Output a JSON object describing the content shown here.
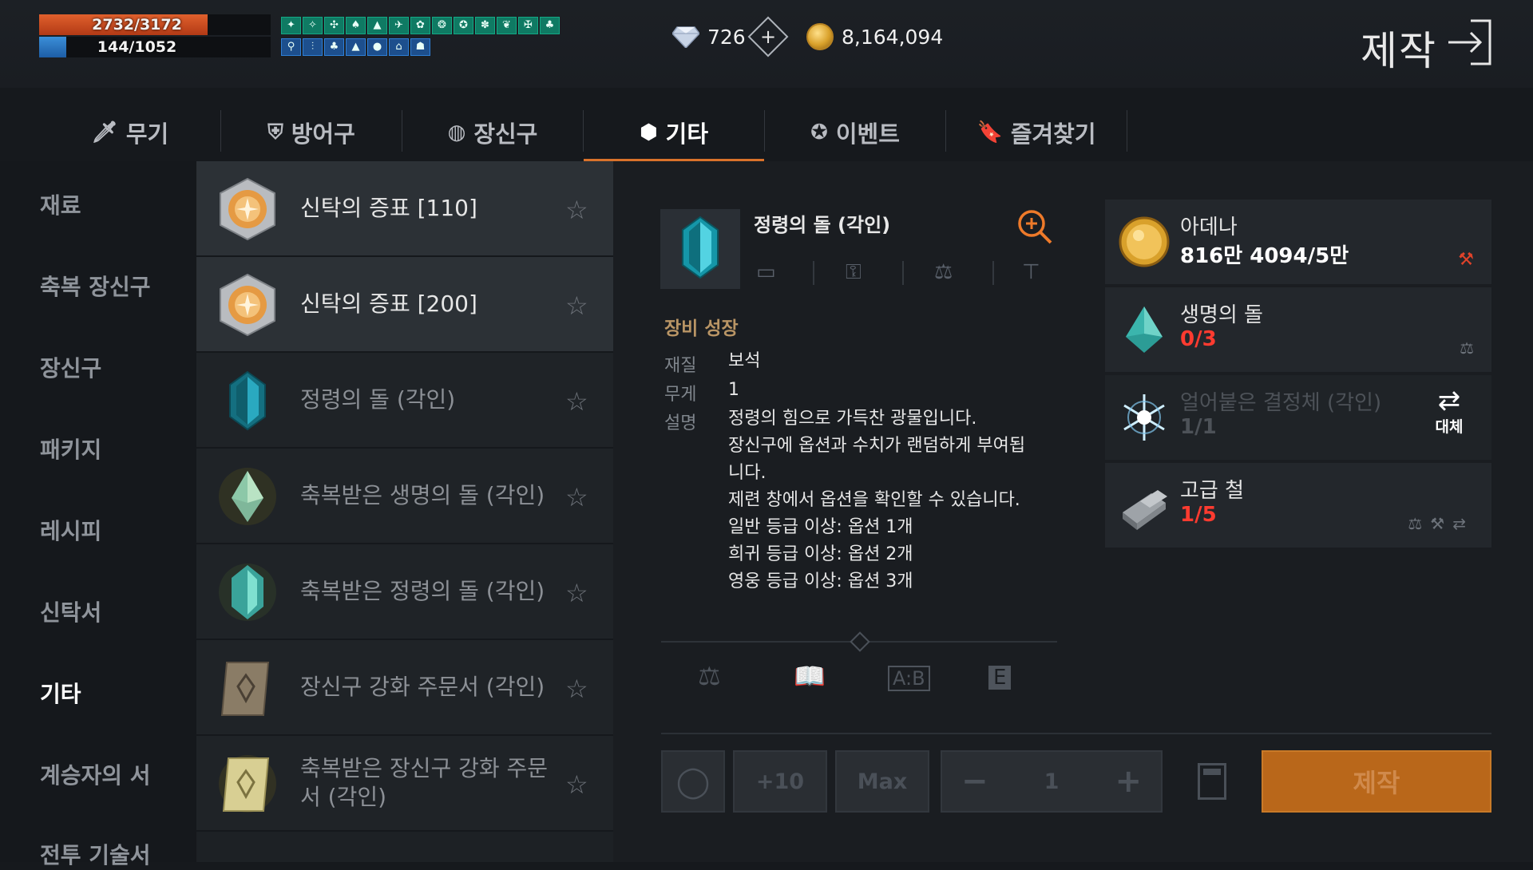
{
  "status": {
    "hp": "2732/3172",
    "mp": "144/1052",
    "hp_fraction": 0.861,
    "mp_fraction": 0.137
  },
  "currency": {
    "diamond": "726",
    "adena": "8,164,094"
  },
  "header": {
    "title": "제작"
  },
  "tabs": [
    {
      "label": "무기",
      "icon": "sword-icon"
    },
    {
      "label": "방어구",
      "icon": "shield-icon"
    },
    {
      "label": "장신구",
      "icon": "ring-icon"
    },
    {
      "label": "기타",
      "icon": "cube-icon",
      "active": true
    },
    {
      "label": "이벤트",
      "icon": "event-icon"
    },
    {
      "label": "즐겨찾기",
      "icon": "bookmark-icon"
    }
  ],
  "sidebar": {
    "items": [
      {
        "label": "재료"
      },
      {
        "label": "축복 장신구"
      },
      {
        "label": "장신구"
      },
      {
        "label": "패키지"
      },
      {
        "label": "레시피"
      },
      {
        "label": "신탁서"
      },
      {
        "label": "기타",
        "active": true
      },
      {
        "label": "계승자의 서"
      },
      {
        "label": "전투 기술서"
      }
    ]
  },
  "items": [
    {
      "name": "신탁의 증표 [110]",
      "icon": "oracle-token-icon",
      "available": true
    },
    {
      "name": "신탁의 증표 [200]",
      "icon": "oracle-token-icon",
      "available": true
    },
    {
      "name": "정령의 돌 (각인)",
      "icon": "spirit-stone-icon",
      "available": false
    },
    {
      "name": "축복받은 생명의 돌 (각인)",
      "icon": "blessed-life-stone-icon",
      "available": false
    },
    {
      "name": "축복받은 정령의 돌 (각인)",
      "icon": "blessed-spirit-stone-icon",
      "available": false
    },
    {
      "name": "장신구 강화 주문서 (각인)",
      "icon": "scroll-icon",
      "available": false
    },
    {
      "name": "축복받은 장신구 강화 주문서 (각인)",
      "icon": "blessed-scroll-icon",
      "available": false
    }
  ],
  "detail": {
    "title": "정령의 돌 (각인)",
    "section": "장비 성장",
    "material_label": "재질",
    "material": "보석",
    "weight_label": "무게",
    "weight": "1",
    "desc_label": "설명",
    "desc_lines": [
      "정령의 힘으로 가득찬 광물입니다.",
      "장신구에 옵션과 수치가 랜덤하게 부여됩",
      "니다.",
      "제련 창에서 옵션을 확인할 수 있습니다.",
      "일반 등급 이상: 옵션 1개",
      "희귀 등급 이상: 옵션 2개",
      "영웅 등급 이상: 옵션 3개"
    ]
  },
  "materials": [
    {
      "name": "아데나",
      "count": "816만 4094/5만",
      "count_color": "#ffffff",
      "icon": "adena-coin-icon",
      "enough": true
    },
    {
      "name": "생명의 돌",
      "count": "0/3",
      "count_color": "#ff3b30",
      "icon": "life-stone-icon",
      "enough": false
    },
    {
      "name": "얼어붙은 결정체 (각인)",
      "count": "1/1",
      "count_color": "#5c6167",
      "icon": "frozen-crystal-icon",
      "enough": true,
      "substitute_label": "대체"
    },
    {
      "name": "고급 철",
      "count": "1/5",
      "count_color": "#ff3b30",
      "icon": "iron-ingot-icon",
      "enough": false
    }
  ],
  "controls": {
    "plus10": "+10",
    "max": "Max",
    "quantity": "1",
    "craft": "제작"
  }
}
